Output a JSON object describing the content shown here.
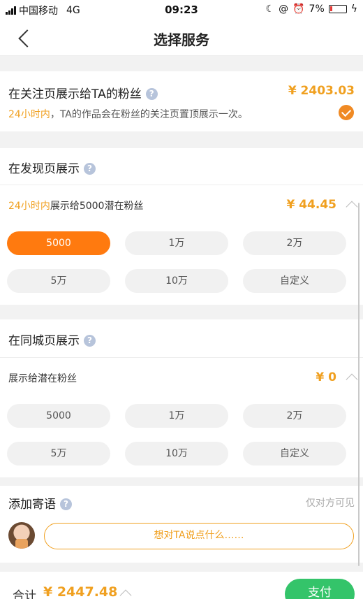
{
  "status_bar": {
    "carrier": "中国移动",
    "network": "4G",
    "time": "09:23",
    "battery_percent": "7%"
  },
  "nav": {
    "title": "选择服务"
  },
  "follow_section": {
    "title": "在关注页展示给TA的粉丝",
    "price": "¥ 2403.03",
    "desc_highlight": "24小时内",
    "desc_rest": "，TA的作品会在粉丝的关注页置顶展示一次。",
    "selected": true
  },
  "discover_section": {
    "title": "在发现页展示",
    "desc_highlight": "24小时内",
    "desc_rest": "展示给5000潜在粉丝",
    "price": "¥ 44.45",
    "options": [
      "5000",
      "1万",
      "2万",
      "5万",
      "10万",
      "自定义"
    ],
    "selected_index": 0
  },
  "city_section": {
    "title": "在同城页展示",
    "desc": "展示给潜在粉丝",
    "price": "¥ 0",
    "options": [
      "5000",
      "1万",
      "2万",
      "5万",
      "10万",
      "自定义"
    ]
  },
  "message_section": {
    "title": "添加寄语",
    "visibility_note": "仅对方可见",
    "input_placeholder": "想对TA说点什么……"
  },
  "footer": {
    "total_label": "合计",
    "total_value": "¥ 2447.48",
    "pay_label": "支付"
  },
  "colors": {
    "accent_orange": "#ff7a0f",
    "price_orange": "#f0a020",
    "pay_green": "#34c46a"
  }
}
